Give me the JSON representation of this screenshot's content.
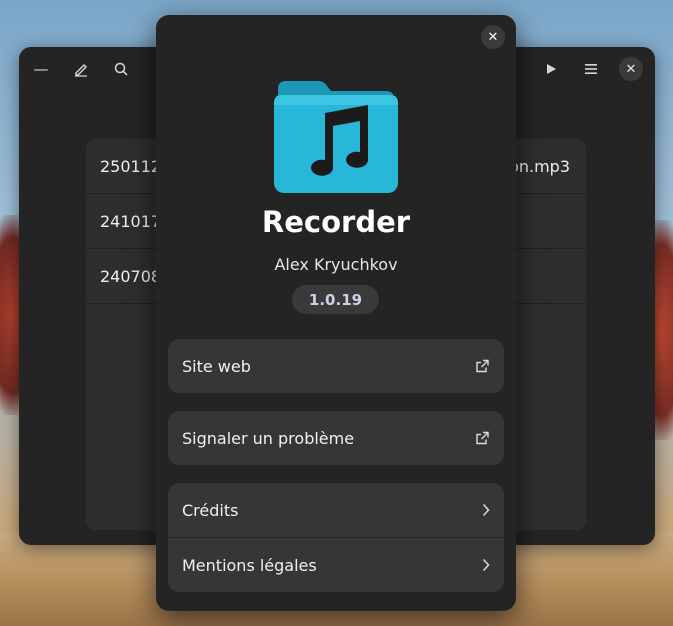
{
  "main_window": {
    "files": [
      {
        "name": "250112",
        "suffix": "on.mp3"
      },
      {
        "name": "241017",
        "suffix": ""
      },
      {
        "name": "240708",
        "suffix": ""
      }
    ]
  },
  "about": {
    "app_name": "Recorder",
    "developer": "Alex Kryuchkov",
    "version": "1.0.19",
    "links": {
      "website": "Site web",
      "report_issue": "Signaler un problème"
    },
    "nav": {
      "credits": "Crédits",
      "legal": "Mentions légales"
    },
    "icon_color": "#28b7d9",
    "icon_color_back": "#1e97b7"
  }
}
